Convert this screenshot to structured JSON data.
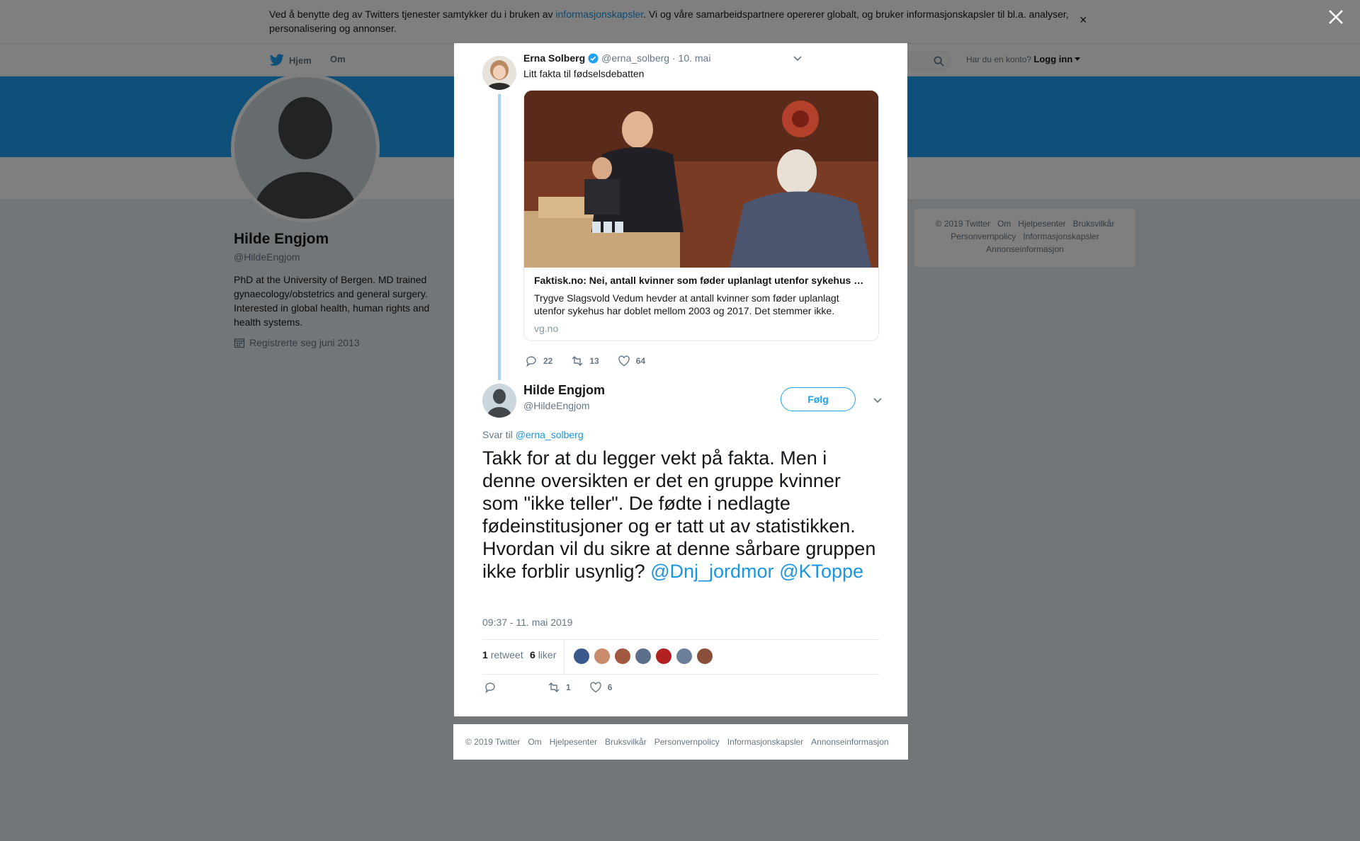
{
  "cookie_bar": {
    "text_before": "Ved å benytte deg av Twitters tjenester samtykker du i bruken av ",
    "link": "informasjonskapsler",
    "text_after": ". Vi og våre samarbeidspartnere opererer globalt, og bruker informasjonskapsler til bl.a. analyser, personalisering og annonser.",
    "close": "×"
  },
  "nav": {
    "home": "Hjem",
    "about": "Om",
    "login_prompt": "Har du en konto?",
    "login": "Logg inn"
  },
  "profile": {
    "name": "Hilde Engjom",
    "handle": "@HildeEngjom",
    "bio": "PhD at the University of Bergen. MD trained gynaecology/obstetrics and general surgery. Interested in global health, human rights and health systems.",
    "joined": "Registrerte seg juni 2013"
  },
  "side_footer": {
    "links": [
      "© 2019 Twitter",
      "Om",
      "Hjelpesenter",
      "Bruksvilkår",
      "Personvernpolicy",
      "Informasjonskapsler",
      "Annonseinformasjon"
    ]
  },
  "parent_tweet": {
    "name": "Erna Solberg",
    "handle": "@erna_solberg",
    "date": "10. mai",
    "text": "Litt fakta til fødselsdebatten",
    "card": {
      "title": "Faktisk.no: Nei, antall kvinner som føder uplanlagt utenfor sykehus har ikke doblet seg",
      "description": "Trygve Slagsvold Vedum hevder at antall kvinner som føder uplanlagt utenfor sykehus har doblet mellom 2003 og 2017. Det stemmer ikke.",
      "domain": "vg.no"
    },
    "replies": "22",
    "retweets": "13",
    "likes": "64"
  },
  "reply_tweet": {
    "name": "Hilde Engjom",
    "handle": "@HildeEngjom",
    "follow": "Følg",
    "reply_to_label": "Svar til ",
    "reply_to": "@erna_solberg",
    "text": "Takk for at du legger vekt på fakta. Men i denne oversikten er det en gruppe kvinner som \"ikke teller\". De fødte i nedlagte fødeinstitusjoner og er tatt ut av statistikken. Hvordan vil du sikre at denne sårbare gruppen ikke forblir usynlig? ",
    "mention1": "@Dnj_jordmor",
    "mention2": "@KToppe",
    "timestamp": "09:37 - 11. mai 2019",
    "retweet_count": "1",
    "retweet_label": "retweet",
    "like_count": "6",
    "like_label": "liker",
    "action_retweets": "1",
    "action_likes": "6",
    "liker_colors": [
      "#3a5a8c",
      "#c98b6b",
      "#a0583f",
      "#5c6f8a",
      "#b22222",
      "#6b7f99",
      "#8a4f3a"
    ]
  },
  "modal_footer": {
    "links": [
      "© 2019 Twitter",
      "Om",
      "Hjelpesenter",
      "Bruksvilkår",
      "Personvernpolicy",
      "Informasjonskapsler",
      "Annonseinformasjon"
    ]
  },
  "colors": {
    "accent": "#1da1f2",
    "link": "#1b95e0"
  }
}
